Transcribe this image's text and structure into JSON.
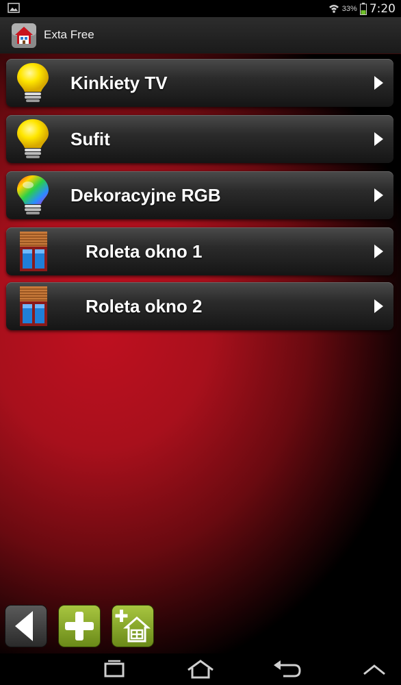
{
  "status_bar": {
    "battery_percent": "33%",
    "time": "7:20"
  },
  "action_bar": {
    "title": "Exta Free"
  },
  "items": [
    {
      "label": "Kinkiety TV",
      "icon": "bulb-yellow-icon"
    },
    {
      "label": "Sufit",
      "icon": "bulb-yellow-icon"
    },
    {
      "label": "Dekoracyjne RGB",
      "icon": "bulb-rgb-icon"
    },
    {
      "label": "Roleta okno 1",
      "icon": "roller-blind-icon"
    },
    {
      "label": "Roleta okno 2",
      "icon": "roller-blind-icon"
    }
  ],
  "bottom_buttons": [
    "back-icon",
    "add-icon",
    "add-room-icon"
  ],
  "nav_bar": [
    "recent-apps-icon",
    "home-icon",
    "back-icon",
    "up-arrow-icon"
  ],
  "colors": {
    "background_red": "#c01020",
    "button_green": "#8cb02a",
    "tile_dark": "#2b2b2b"
  }
}
